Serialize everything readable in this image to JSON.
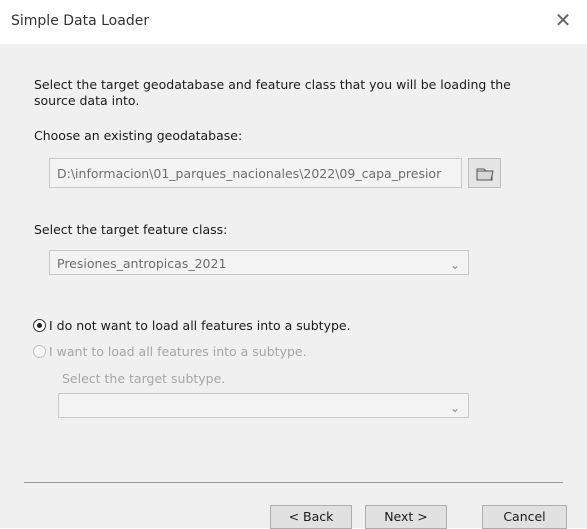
{
  "window": {
    "title": "Simple Data Loader"
  },
  "content": {
    "intro": "Select the target geodatabase and feature class that you will be loading the source data into.",
    "geodatabase_label": "Choose an existing geodatabase:",
    "geodatabase_path": "D:\\informacion\\01_parques_nacionales\\2022\\09_capa_presior",
    "feature_class_label": "Select the target feature class:",
    "feature_class_value": "Presiones_antropicas_2021",
    "option_no_subtype": "I do not want to load all features into a subtype.",
    "option_subtype": "I want to load all features into a subtype.",
    "subtype_label": "Select the target subtype.",
    "subtype_value": ""
  },
  "buttons": {
    "back": "< Back",
    "next": "Next >",
    "cancel": "Cancel"
  },
  "icons": {
    "close": "close-icon",
    "folder": "open-folder-icon",
    "dropdown": "chevron-down-icon"
  },
  "state": {
    "selected_option": "option_no_subtype"
  }
}
